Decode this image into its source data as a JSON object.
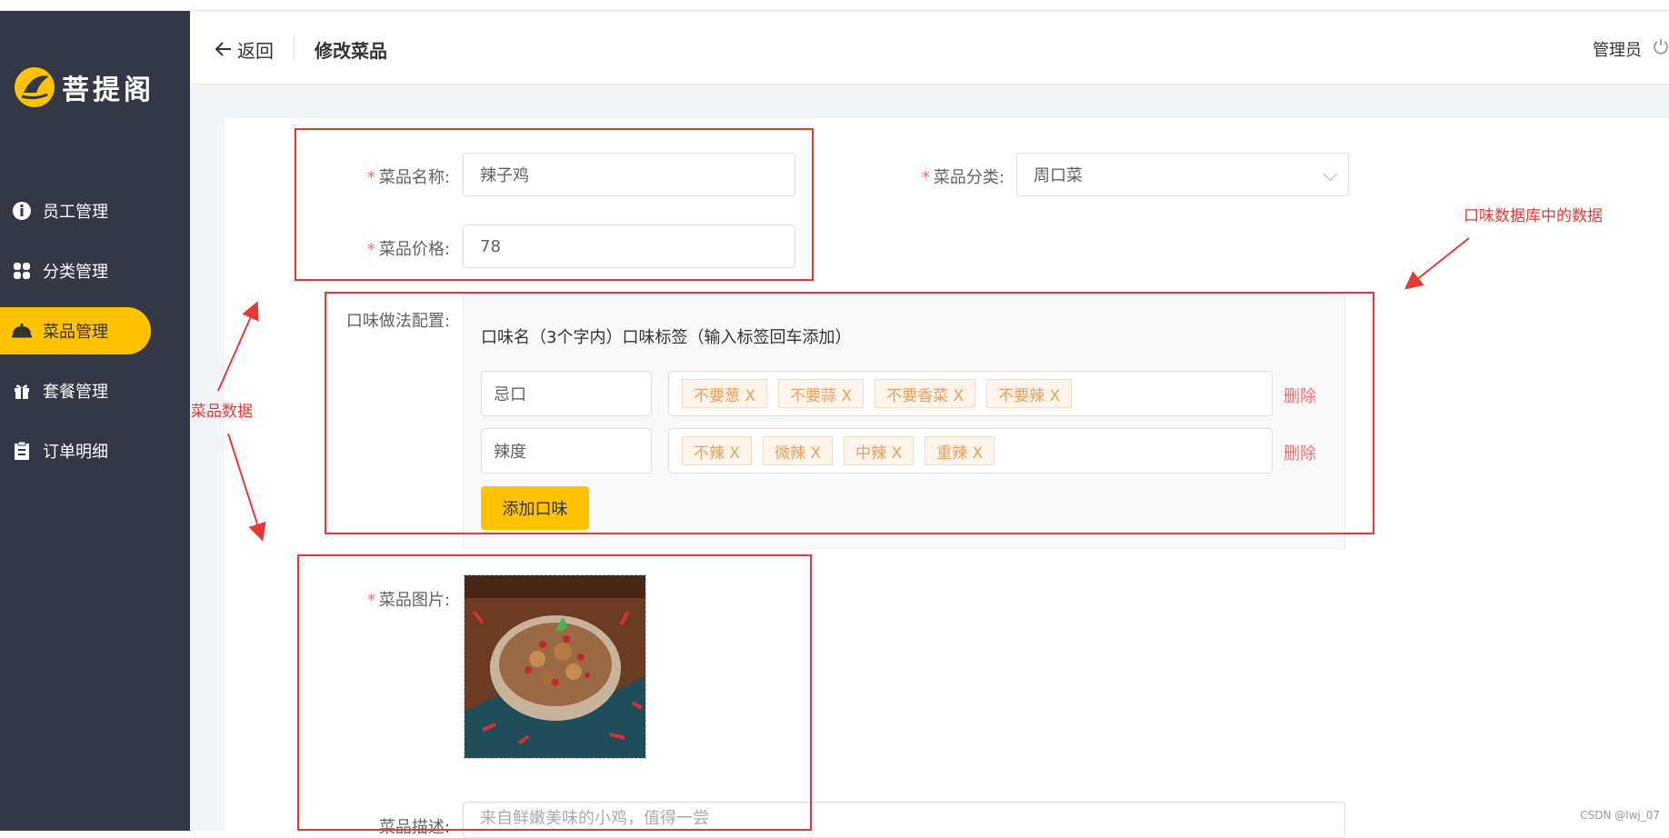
{
  "sidebar": {
    "logo_text": "菩提阁",
    "items": [
      {
        "label": "员工管理",
        "icon": "employee-icon"
      },
      {
        "label": "分类管理",
        "icon": "category-grid-icon"
      },
      {
        "label": "菜品管理",
        "icon": "dish-cloche-icon",
        "active": true
      },
      {
        "label": "套餐管理",
        "icon": "gift-icon"
      },
      {
        "label": "订单明细",
        "icon": "clipboard-icon"
      }
    ]
  },
  "header": {
    "back_label": "返回",
    "title": "修改菜品",
    "user": "管理员"
  },
  "form": {
    "name_label": "菜品名称:",
    "name_value": "辣子鸡",
    "category_label": "菜品分类:",
    "category_value": "周口菜",
    "price_label": "菜品价格:",
    "price_value": "78",
    "flavor_label": "口味做法配置:",
    "flavor_head_name": "口味名（3个字内）",
    "flavor_head_tags": "口味标签（输入标签回车添加）",
    "flavors": [
      {
        "name": "忌口",
        "tags": [
          "不要葱 X",
          "不要蒜 X",
          "不要香菜 X",
          "不要辣 X"
        ]
      },
      {
        "name": "辣度",
        "tags": [
          "不辣 X",
          "微辣 X",
          "中辣 X",
          "重辣 X"
        ]
      }
    ],
    "delete_label": "删除",
    "add_flavor_label": "添加口味",
    "image_label": "菜品图片:",
    "desc_label": "菜品描述:",
    "desc_placeholder": "来自鲜嫩美味的小鸡，值得一尝"
  },
  "annotations": {
    "dish_data": "菜品数据",
    "flavor_db": "口味数据库中的数据"
  },
  "colors": {
    "sidebar_bg": "#343744",
    "accent": "#ffc200",
    "annotation": "#e53935",
    "tag_text": "#f19c59"
  },
  "watermark": "CSDN @lwj_07"
}
